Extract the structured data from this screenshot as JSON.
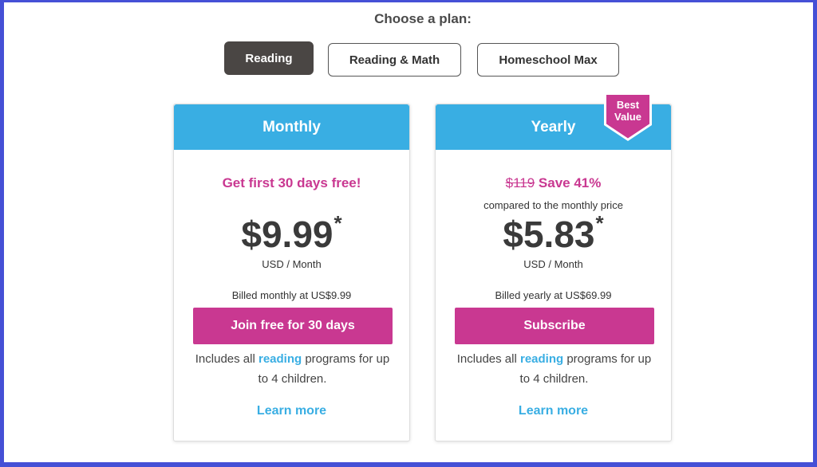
{
  "heading": "Choose a plan:",
  "tabs": [
    {
      "label": "Reading",
      "active": true
    },
    {
      "label": "Reading & Math",
      "active": false
    },
    {
      "label": "Homeschool Max",
      "active": false
    }
  ],
  "plans": {
    "monthly": {
      "title": "Monthly",
      "promo": "Get first 30 days free!",
      "price": "$9.99",
      "asterisk": "*",
      "unit": "USD / Month",
      "billed": "Billed monthly at US$9.99",
      "cta": "Join free for 30 days",
      "includes_pre": "Includes all ",
      "includes_kw": "reading",
      "includes_post": " programs for up to 4 children.",
      "learn_more": "Learn more"
    },
    "yearly": {
      "title": "Yearly",
      "badge_line1": "Best",
      "badge_line2": "Value",
      "old_price": "$119",
      "save": "Save 41%",
      "compare": "compared to the monthly price",
      "price": "$5.83",
      "asterisk": "*",
      "unit": "USD / Month",
      "billed": "Billed yearly at US$69.99",
      "cta": "Subscribe",
      "includes_pre": "Includes all ",
      "includes_kw": "reading",
      "includes_post": " programs for up to 4 children.",
      "learn_more": "Learn more"
    }
  },
  "colors": {
    "header_blue": "#39aee3",
    "accent_magenta": "#c93891",
    "active_tab": "#4a4644",
    "frame": "#4550d6"
  }
}
